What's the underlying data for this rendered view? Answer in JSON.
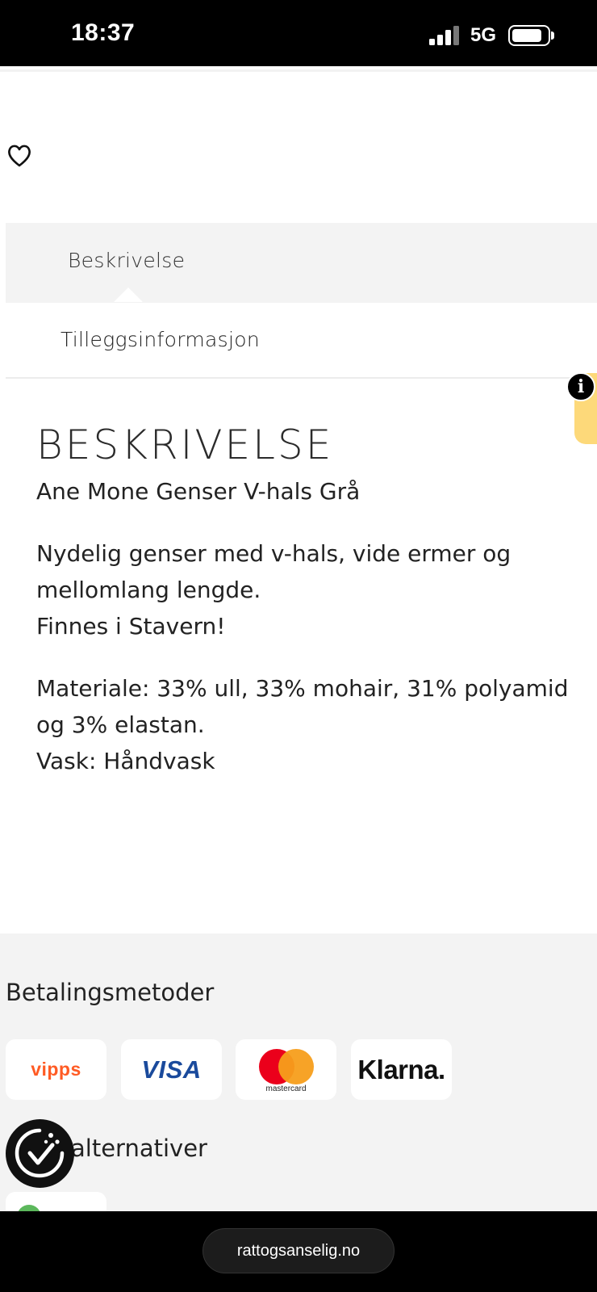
{
  "status_bar": {
    "time": "18:37",
    "network": "5G",
    "icons": [
      "signal-icon",
      "battery-icon"
    ]
  },
  "product": {
    "wishlist_icon": "heart-outline-icon",
    "tabs": [
      {
        "label": "Beskrivelse",
        "active": true
      },
      {
        "label": "Tilleggsinformasjon",
        "active": false
      }
    ],
    "description": {
      "heading": "BESKRIVELSE",
      "name": "Ane Mone Genser V-hals Grå",
      "paragraph1": [
        "Nydelig genser med v-hals, vide ermer og mellomlang lengde.",
        "Finnes i Stavern!"
      ],
      "paragraph2": [
        "Materiale: 33% ull, 33% mohair, 31% polyamid og 3% elastan.",
        "Vask: Håndvask"
      ]
    }
  },
  "info_widget": {
    "badge": "i"
  },
  "footer": {
    "payment_heading": "Betalingsmetoder",
    "payment_methods": [
      {
        "name": "vipps",
        "label": "vipps",
        "color": "#ff5b24"
      },
      {
        "name": "visa",
        "label": "VISA",
        "color": "#1a4a9c"
      },
      {
        "name": "mastercard",
        "label": "mastercard",
        "colors": [
          "#eb001b",
          "#f79e1b"
        ]
      },
      {
        "name": "klarna",
        "label": "Klarna."
      }
    ],
    "delivery_heading_visible": "alternativer"
  },
  "browser": {
    "url": "rattogsanselig.no"
  }
}
